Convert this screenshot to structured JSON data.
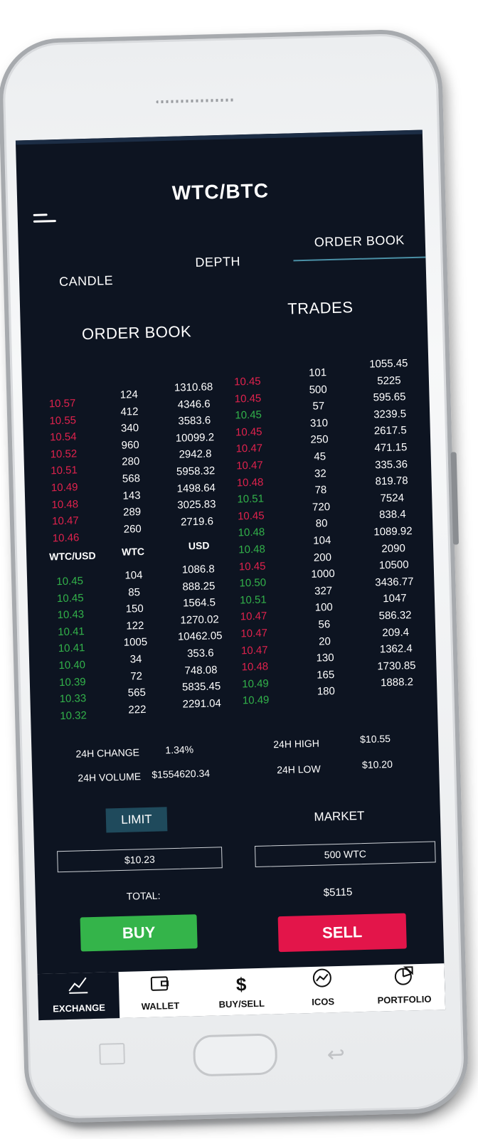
{
  "header": {
    "title": "WTC/BTC"
  },
  "tabs": [
    "CANDLE",
    "DEPTH",
    "ORDER BOOK"
  ],
  "order_book": {
    "heading": "ORDER BOOK",
    "asks": {
      "price": [
        "10.57",
        "10.55",
        "10.54",
        "10.52",
        "10.51",
        "10.49",
        "10.48",
        "10.47",
        "10.46"
      ],
      "wtc": [
        "124",
        "412",
        "340",
        "960",
        "280",
        "568",
        "143",
        "289",
        "260"
      ],
      "usd": [
        "1310.68",
        "4346.6",
        "3583.6",
        "10099.2",
        "2942.8",
        "5958.32",
        "1498.64",
        "3025.83",
        "2719.6"
      ]
    },
    "columns": {
      "pair": "WTC/USD",
      "wtc": "WTC",
      "usd": "USD"
    },
    "bids": {
      "price": [
        "10.45",
        "10.45",
        "10.43",
        "10.41",
        "10.41",
        "10.40",
        "10.39",
        "10.33",
        "10.32"
      ],
      "wtc": [
        "104",
        "85",
        "150",
        "122",
        "1005",
        "34",
        "72",
        "565",
        "222"
      ],
      "usd": [
        "1086.8",
        "888.25",
        "1564.5",
        "1270.02",
        "10462.05",
        "353.6",
        "748.08",
        "5835.45",
        "2291.04"
      ]
    }
  },
  "trades": {
    "heading": "TRADES",
    "price": [
      "10.45",
      "10.45",
      "10.45",
      "10.45",
      "10.47",
      "10.47",
      "10.48",
      "10.51",
      "10.45",
      "10.48",
      "10.48",
      "10.45",
      "10.50",
      "10.51",
      "10.47",
      "10.47",
      "10.47",
      "10.48",
      "10.49",
      "10.49"
    ],
    "price_colors": [
      "red",
      "red",
      "green",
      "red",
      "red",
      "red",
      "red",
      "green",
      "red",
      "green",
      "green",
      "red",
      "green",
      "green",
      "red",
      "red",
      "red",
      "red",
      "green",
      "green"
    ],
    "amount": [
      "101",
      "500",
      "57",
      "310",
      "250",
      "45",
      "32",
      "78",
      "720",
      "80",
      "104",
      "200",
      "1000",
      "327",
      "100",
      "56",
      "20",
      "130",
      "165",
      "180"
    ],
    "total": [
      "1055.45",
      "5225",
      "595.65",
      "3239.5",
      "2617.5",
      "471.15",
      "335.36",
      "819.78",
      "7524",
      "838.4",
      "1089.92",
      "2090",
      "10500",
      "3436.77",
      "1047",
      "586.32",
      "209.4",
      "1362.4",
      "1730.85",
      "1888.2"
    ]
  },
  "stats": {
    "change_label": "24H CHANGE",
    "change_value": "1.34%",
    "volume_label": "24H VOLUME",
    "volume_value": "$1554620.34",
    "high_label": "24H HIGH",
    "high_value": "$10.55",
    "low_label": "24H LOW",
    "low_value": "$10.20"
  },
  "order_form": {
    "limit_label": "LIMIT",
    "market_label": "MARKET",
    "price_value": "$10.23",
    "amount_value": "500 WTC",
    "total_label": "TOTAL:",
    "total_value": "$5115",
    "buy_label": "BUY",
    "sell_label": "SELL"
  },
  "bottom_nav": [
    {
      "label": "EXCHANGE",
      "icon": "exchange-chart-icon",
      "glyph": "📈"
    },
    {
      "label": "WALLET",
      "icon": "wallet-icon",
      "glyph": "👛"
    },
    {
      "label": "BUY/SELL",
      "icon": "dollar-icon",
      "glyph": "$"
    },
    {
      "label": "ICOS",
      "icon": "ico-chart-icon",
      "glyph": "◎"
    },
    {
      "label": "PORTFOLIO",
      "icon": "pie-chart-icon",
      "glyph": "◔"
    }
  ],
  "colors": {
    "screen_bg": "#0d1421",
    "ask_red": "#e0224d",
    "bid_green": "#32b24a",
    "buy_green": "#34b44a",
    "sell_red": "#e3154a",
    "limit_bg": "#1f4a5c",
    "tab_underline": "#4a90a6"
  }
}
